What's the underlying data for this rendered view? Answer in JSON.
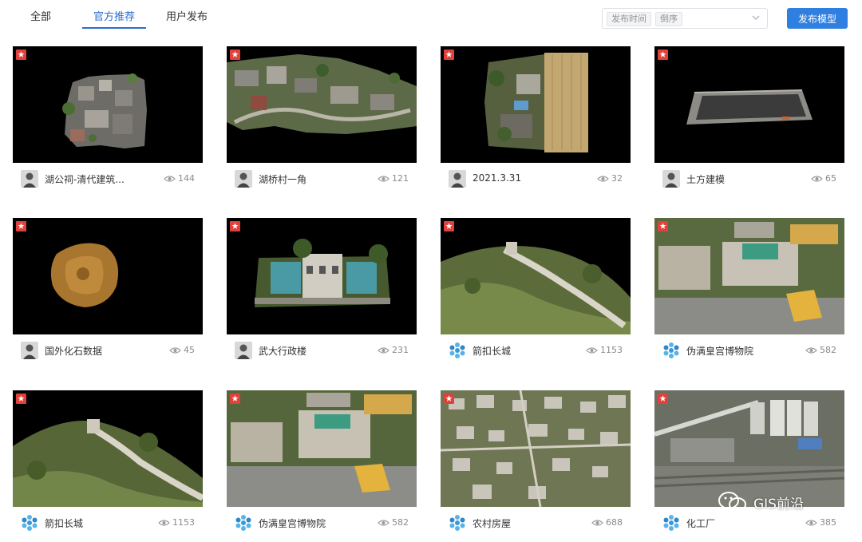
{
  "tabs": [
    {
      "label": "全部",
      "active": false
    },
    {
      "label": "官方推荐",
      "active": true
    },
    {
      "label": "用户发布",
      "active": false
    }
  ],
  "sort": {
    "field": "发布时间",
    "order": "倒序"
  },
  "publish_button": "发布模型",
  "colors": {
    "accent": "#2b6fcf",
    "button": "#2f7fe0",
    "badge": "#e0413b"
  },
  "cards": [
    {
      "title": "湖公祠-清代建筑...",
      "views": "144",
      "avatar": "person"
    },
    {
      "title": "湖桥村一角",
      "views": "121",
      "avatar": "person"
    },
    {
      "title": "2021.3.31",
      "views": "32",
      "avatar": "person"
    },
    {
      "title": "土方建模",
      "views": "65",
      "avatar": "person"
    },
    {
      "title": "国外化石数据",
      "views": "45",
      "avatar": "person"
    },
    {
      "title": "武大行政楼",
      "views": "231",
      "avatar": "person"
    },
    {
      "title": "箭扣长城",
      "views": "1153",
      "avatar": "logo"
    },
    {
      "title": "伪满皇宫博物院",
      "views": "582",
      "avatar": "logo"
    },
    {
      "title": "箭扣长城",
      "views": "1153",
      "avatar": "logo"
    },
    {
      "title": "伪满皇宫博物院",
      "views": "582",
      "avatar": "logo"
    },
    {
      "title": "农村房屋",
      "views": "688",
      "avatar": "logo"
    },
    {
      "title": "化工厂",
      "views": "385",
      "avatar": "logo"
    }
  ],
  "watermark": "GIS前沿"
}
